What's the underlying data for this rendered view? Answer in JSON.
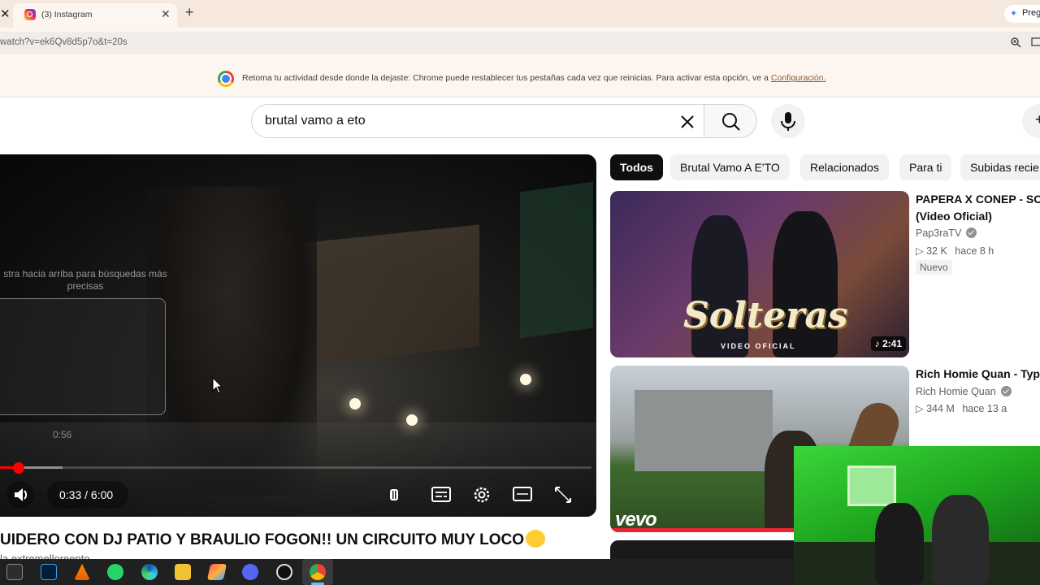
{
  "browser": {
    "tab_title": "(3) Instagram",
    "url": "watch?v=ek6Qv8d5p7o&t=20s",
    "gemini_label": "Pregunt",
    "infobar_text": "Retoma tu actividad desde donde la dejaste: Chrome puede restablecer tus pestañas cada vez que reinicias. Para activar esta opción, ve a",
    "infobar_link": "Configuración."
  },
  "youtube": {
    "search_value": "brutal vamo a eto",
    "player": {
      "seek_hint": "stra hacia arriba para búsquedas más precisas",
      "preview_time": "0:56",
      "time_display": "0:33 / 6:00",
      "progress_fraction": 0.055,
      "buffered_fraction": 0.128
    },
    "video_title": "UIDERO CON DJ PATIO Y BRAULIO FOGON!! UN CIRCUITO MUY LOCO",
    "channel_cut": "la.extremelloreento",
    "chips": [
      "Todos",
      "Brutal Vamo A E'TO",
      "Relacionados",
      "Para ti",
      "Subidas recie"
    ],
    "recommendations": [
      {
        "title_line1": "PAPERA X CONEP - SOL",
        "title_line2": "(Video Oficial)",
        "channel": "Pap3raTV",
        "views": "32 K",
        "age": "hace 8 h",
        "badge": "Nuevo",
        "duration": "♪ 2:41",
        "thumb_text": "Solteras",
        "thumb_sub": "VIDEO OFICIAL"
      },
      {
        "title_line1": "Rich Homie Quan - Type",
        "channel": "Rich Homie Quan",
        "views": "344 M",
        "age": "hace 13 a",
        "thumb_logo": "vevo"
      }
    ]
  },
  "icons": [
    "close-icon",
    "instagram-icon",
    "plus-icon",
    "gemini-icon",
    "zoom-icon",
    "cast-icon",
    "chrome-icon",
    "clear-icon",
    "search-icon",
    "mic-icon",
    "volume-icon",
    "pause-icon",
    "subtitles-icon",
    "settings-icon",
    "theater-icon",
    "fullscreen-icon",
    "verified-icon",
    "views-icon"
  ],
  "colors": {
    "accent_red": "#ff0000",
    "tab_bar": "#f6e8dc",
    "chip_active": "#0f0f0f"
  }
}
